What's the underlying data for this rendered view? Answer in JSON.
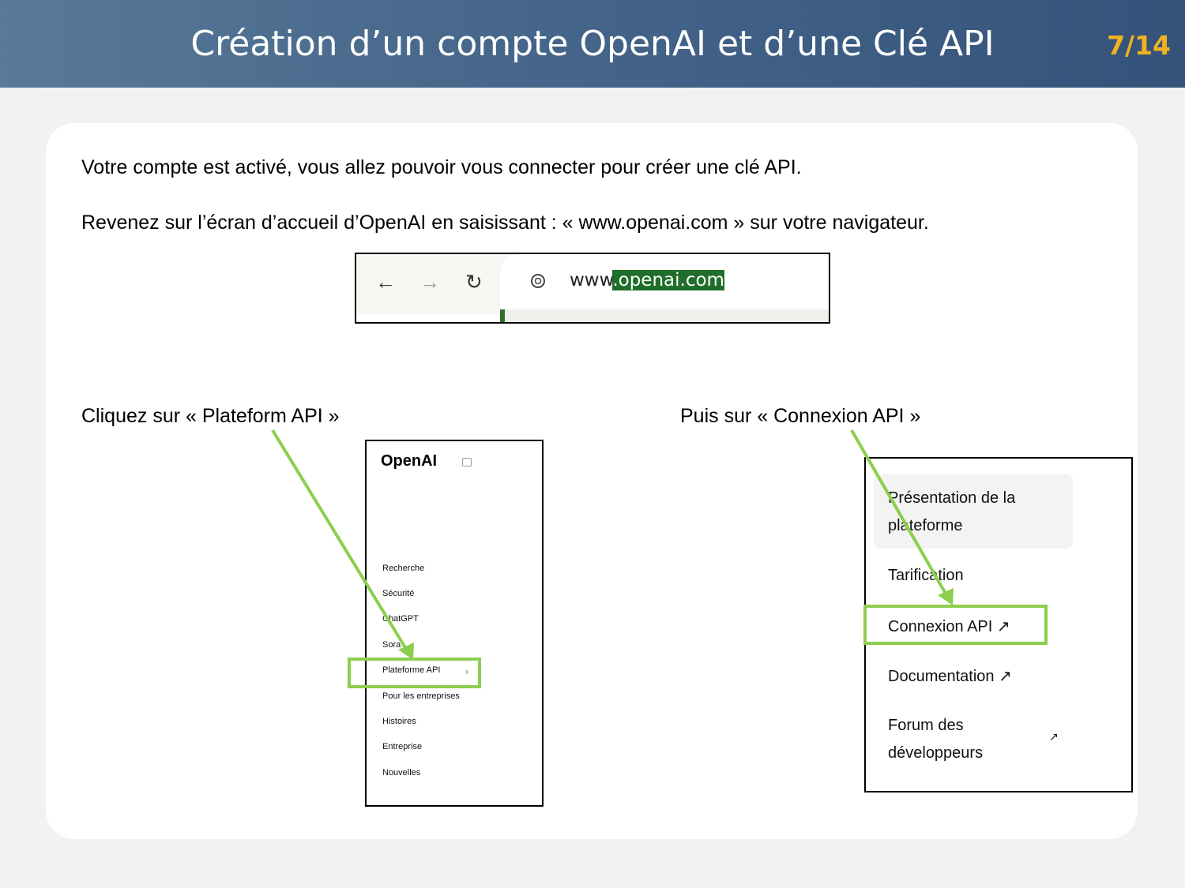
{
  "header": {
    "title": "Création d’un compte OpenAI et d’une Clé API",
    "page": "7/14"
  },
  "instructions": {
    "line1": "Votre compte est activé, vous allez pouvoir vous connecter pour créer une clé API.",
    "line2": "Revenez sur l’écran d’accueil d’OpenAI en saisissant : « www.openai.com » sur votre navigateur.",
    "step1": "Cliquez  sur « Plateform API »",
    "step2": "Puis sur « Connexion API »"
  },
  "browser": {
    "back_icon": "arrow-left-icon",
    "forward_icon": "arrow-right-icon",
    "reload_icon": "reload-icon",
    "url_prefix": "www",
    "url_highlight": ".openai.com"
  },
  "menu1": {
    "logo": "OpenAI",
    "items": [
      "Recherche",
      "Sécurité",
      "ChatGPT",
      "Sora",
      "Plateforme API",
      "Pour les entreprises",
      "Histoires",
      "Entreprise",
      "Nouvelles"
    ],
    "chevron": "›"
  },
  "menu2": {
    "items": [
      "Présentation de la",
      "plateforme",
      "Tarification",
      "Connexion API ↗",
      "Documentation ↗",
      "Forum des",
      "développeurs",
      "↗"
    ]
  },
  "colors": {
    "highlight": "#8dce4f",
    "page_number": "#f0b31f",
    "url_selection": "#1f6e2a"
  }
}
